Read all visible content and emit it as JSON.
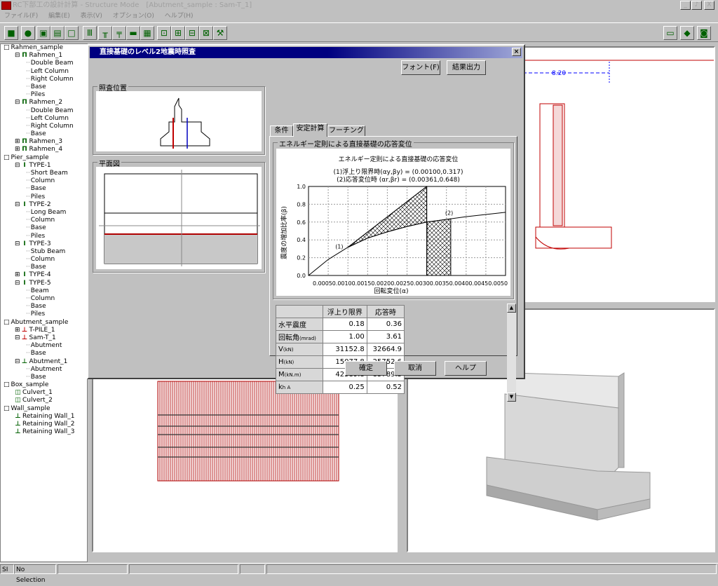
{
  "app": {
    "title": "RC下部工の設計計算 - Structure Mode　[Abutment_sample : Sam-T_1]"
  },
  "window_buttons": [
    "_",
    "♪",
    "X"
  ],
  "menu": [
    "ファイル(F)",
    "編集(E)",
    "表示(V)",
    "オプション(O)",
    "ヘルプ(H)"
  ],
  "toolbar_icons": [
    "save-icon",
    "globe-icon",
    "copy-icon",
    "print-icon",
    "blank-icon",
    "rahmen-icon",
    "pier-icon",
    "t-pier-icon",
    "abutment-icon",
    "grid-icon",
    "box-icon",
    "wall-icon",
    "culvert-icon",
    "frame-icon",
    "tool-icon"
  ],
  "toolbar_right": [
    "window-icon",
    "book-icon",
    "camera-icon"
  ],
  "tree": [
    {
      "d": 0,
      "exp": "□",
      "label": "Rahmen_sample"
    },
    {
      "d": 1,
      "exp": "⊟",
      "icon": "Π",
      "label": "Rahmen_1"
    },
    {
      "d": 2,
      "label": "Double Beam"
    },
    {
      "d": 2,
      "label": "Left Column"
    },
    {
      "d": 2,
      "label": "Right Column"
    },
    {
      "d": 2,
      "label": "Base"
    },
    {
      "d": 2,
      "label": "Piles"
    },
    {
      "d": 1,
      "exp": "⊟",
      "icon": "Π",
      "label": "Rahmen_2"
    },
    {
      "d": 2,
      "label": "Double Beam"
    },
    {
      "d": 2,
      "label": "Left Column"
    },
    {
      "d": 2,
      "label": "Right Column"
    },
    {
      "d": 2,
      "label": "Base"
    },
    {
      "d": 1,
      "exp": "⊞",
      "icon": "Π",
      "label": "Rahmen_3"
    },
    {
      "d": 1,
      "exp": "⊞",
      "icon": "Π",
      "label": "Rahmen_4"
    },
    {
      "d": 0,
      "exp": "□",
      "label": "Pier_sample"
    },
    {
      "d": 1,
      "exp": "⊟",
      "icon": "I",
      "label": "TYPE-1"
    },
    {
      "d": 2,
      "label": "Short Beam"
    },
    {
      "d": 2,
      "label": "Column"
    },
    {
      "d": 2,
      "label": "Base"
    },
    {
      "d": 2,
      "label": "Piles"
    },
    {
      "d": 1,
      "exp": "⊟",
      "icon": "I",
      "label": "TYPE-2"
    },
    {
      "d": 2,
      "label": "Long Beam"
    },
    {
      "d": 2,
      "label": "Column"
    },
    {
      "d": 2,
      "label": "Base"
    },
    {
      "d": 2,
      "label": "Piles"
    },
    {
      "d": 1,
      "exp": "⊟",
      "icon": "I",
      "label": "TYPE-3"
    },
    {
      "d": 2,
      "label": "Stub Beam"
    },
    {
      "d": 2,
      "label": "Column"
    },
    {
      "d": 2,
      "label": "Base"
    },
    {
      "d": 1,
      "exp": "⊞",
      "icon": "I",
      "label": "TYPE-4"
    },
    {
      "d": 1,
      "exp": "⊟",
      "icon": "I",
      "label": "TYPE-5"
    },
    {
      "d": 2,
      "label": "Beam"
    },
    {
      "d": 2,
      "label": "Column"
    },
    {
      "d": 2,
      "label": "Base"
    },
    {
      "d": 2,
      "label": "Piles"
    },
    {
      "d": 0,
      "exp": "□",
      "label": "Abutment_sample"
    },
    {
      "d": 1,
      "exp": "⊞",
      "icon": "⊥",
      "red": true,
      "label": "T-PILE_1"
    },
    {
      "d": 1,
      "exp": "⊟",
      "icon": "⊥",
      "red": true,
      "label": "Sam-T_1"
    },
    {
      "d": 2,
      "label": "Abutment"
    },
    {
      "d": 2,
      "label": "Base"
    },
    {
      "d": 1,
      "exp": "⊟",
      "icon": "⊥",
      "label": "Abutment_1"
    },
    {
      "d": 2,
      "label": "Abutment"
    },
    {
      "d": 2,
      "label": "Base"
    },
    {
      "d": 0,
      "exp": "□",
      "label": "Box_sample"
    },
    {
      "d": 1,
      "icon": "◫",
      "label": "Culvert_1"
    },
    {
      "d": 1,
      "icon": "◫",
      "label": "Culvert_2"
    },
    {
      "d": 0,
      "exp": "□",
      "label": "Wall_sample"
    },
    {
      "d": 1,
      "icon": "⊥",
      "label": "Retaining Wall_1"
    },
    {
      "d": 1,
      "icon": "⊥",
      "label": "Retaining Wall_2"
    },
    {
      "d": 1,
      "icon": "⊥",
      "label": "Retaining Wall_3"
    }
  ],
  "dimension_label": "8.20",
  "dialog": {
    "title": "直接基礎のレベル2地震時照査",
    "close": "×",
    "font_button": "フォント(F)",
    "export_button": "結果出力",
    "position_group": "照査位置",
    "plan_group": "平面図",
    "tabs": [
      "条件",
      "安定計算",
      "フーチング"
    ],
    "active_tab": 1,
    "energy_group": "エネルギー定則による直接基礎の応答変位",
    "ok_button": "確定",
    "cancel_button": "取消",
    "help_button": "ヘルプ",
    "scroll_up": "▲",
    "scroll_down": "▼"
  },
  "chart_data": {
    "type": "line",
    "title": "エネルギー定則による直接基礎の応答変位",
    "subtitle_lines": [
      "(1)浮上り限界時(αy,βy) = (0.00100,0.317)",
      "(2)応答変位時 (αr,βr) = (0.00361,0.648)"
    ],
    "xlabel": "回転変位(α)",
    "ylabel": "震度の増加比率(β)",
    "xlim": [
      0,
      0.005
    ],
    "ylim": [
      0,
      1.0
    ],
    "yticks": [
      "0.0",
      "0.2",
      "0.4",
      "0.6",
      "0.8",
      "1.0"
    ],
    "xtick_text": "0.00050.00100.00150.00200.00250.00300.00350.00400.00450.0050",
    "grid": true,
    "series": [
      {
        "x": [
          0,
          0.0005,
          0.001,
          0.0015,
          0.002,
          0.0025,
          0.003,
          0.0035,
          0.004,
          0.0045,
          0.005
        ],
        "y": [
          0,
          0.18,
          0.317,
          0.42,
          0.49,
          0.55,
          0.6,
          0.63,
          0.66,
          0.685,
          0.71
        ]
      },
      {
        "x": [
          0.001,
          0.003
        ],
        "y": [
          0.317,
          1.0
        ]
      }
    ],
    "hatched_regions": [
      "loading",
      "response"
    ],
    "point_labels": [
      "(1)",
      "(2)"
    ]
  },
  "results_table": {
    "headers": [
      "",
      "浮上り限界",
      "応答時"
    ],
    "rows": [
      {
        "label": "水平震度",
        "unit": "",
        "v1": "0.18",
        "v2": "0.36"
      },
      {
        "label": "回転角",
        "unit": "(mrad)",
        "v1": "1.00",
        "v2": "3.61"
      },
      {
        "label": "V",
        "unit": "(kN)",
        "v1": "31152.8",
        "v2": "32664.9"
      },
      {
        "label": "H",
        "unit": "(kN)",
        "v1": "15077.8",
        "v2": "25752.6"
      },
      {
        "label": "M",
        "unit": "(kN.m)",
        "v1": "42589.8",
        "v2": "85789.3"
      },
      {
        "label": "k",
        "unit": "h A",
        "v1": "0.25",
        "v2": "0.52"
      }
    ]
  },
  "status": {
    "units": "SI",
    "selection": "No Selection"
  },
  "colors": {
    "rebar": "#b00000",
    "title": "#000080",
    "accent_blue": "#0000ff"
  }
}
